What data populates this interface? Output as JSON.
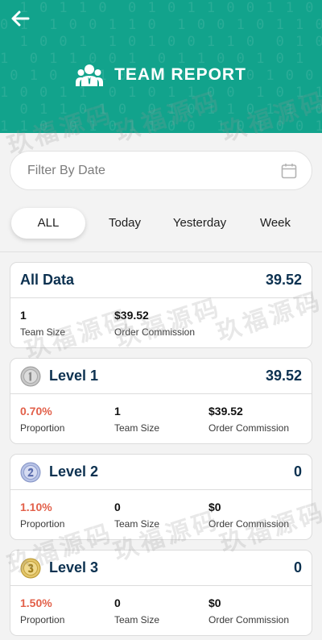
{
  "header": {
    "title": "TEAM REPORT",
    "back_icon": "arrow-left-icon",
    "team_icon": "team-icon",
    "background_color": "#12a38c"
  },
  "filter": {
    "placeholder": "Filter By Date",
    "icon": "calendar-icon"
  },
  "tabs": [
    {
      "label": "ALL",
      "active": true
    },
    {
      "label": "Today",
      "active": false
    },
    {
      "label": "Yesterday",
      "active": false
    },
    {
      "label": "Week",
      "active": false
    }
  ],
  "all_data": {
    "title": "All Data",
    "total": "39.52",
    "team_size_value": "1",
    "team_size_label": "Team Size",
    "commission_value": "$39.52",
    "commission_label": "Order Commission"
  },
  "levels": [
    {
      "name": "Level 1",
      "total": "39.52",
      "medal": "level-1-medal-icon",
      "proportion": "0.70%",
      "proportion_label": "Proportion",
      "team_size": "1",
      "team_size_label": "Team Size",
      "commission": "$39.52",
      "commission_label": "Order Commission"
    },
    {
      "name": "Level 2",
      "total": "0",
      "medal": "level-2-medal-icon",
      "proportion": "1.10%",
      "proportion_label": "Proportion",
      "team_size": "0",
      "team_size_label": "Team Size",
      "commission": "$0",
      "commission_label": "Order Commission"
    },
    {
      "name": "Level 3",
      "total": "0",
      "medal": "level-3-medal-icon",
      "proportion": "1.50%",
      "proportion_label": "Proportion",
      "team_size": "0",
      "team_size_label": "Team Size",
      "commission": "$0",
      "commission_label": "Order Commission"
    }
  ],
  "watermark": "玖福源码",
  "colors": {
    "accent": "#12a38c",
    "heading": "#0c3150",
    "proportion": "#e2604a"
  }
}
